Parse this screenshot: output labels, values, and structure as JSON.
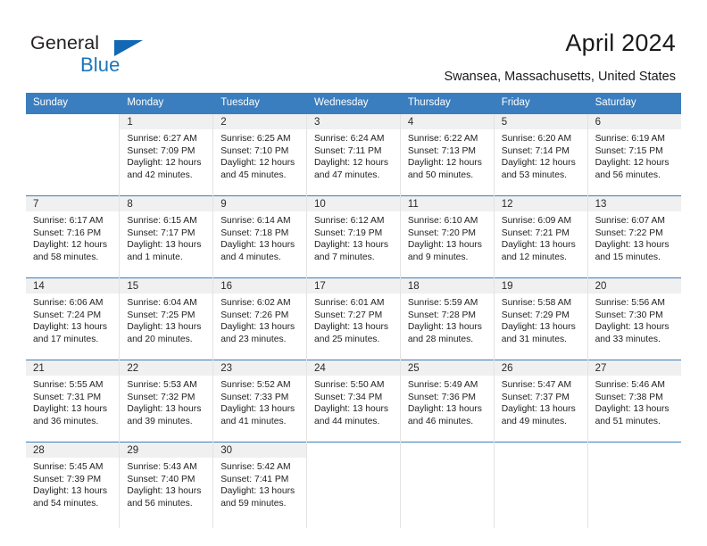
{
  "brand": {
    "name_top": "General",
    "name_bottom": "Blue",
    "accent_color": "#1b75bb",
    "triangle_color": "#1268b3"
  },
  "header": {
    "title": "April 2024",
    "subtitle": "Swansea, Massachusetts, United States"
  },
  "calendar": {
    "header_bg": "#3b7ebf",
    "row_divider_color": "#3b7ebf",
    "day_band_bg": "#f0f0f0",
    "weekdays": [
      "Sunday",
      "Monday",
      "Tuesday",
      "Wednesday",
      "Thursday",
      "Friday",
      "Saturday"
    ],
    "weeks": [
      [
        {
          "day": "",
          "lines": []
        },
        {
          "day": "1",
          "lines": [
            "Sunrise: 6:27 AM",
            "Sunset: 7:09 PM",
            "Daylight: 12 hours and 42 minutes."
          ]
        },
        {
          "day": "2",
          "lines": [
            "Sunrise: 6:25 AM",
            "Sunset: 7:10 PM",
            "Daylight: 12 hours and 45 minutes."
          ]
        },
        {
          "day": "3",
          "lines": [
            "Sunrise: 6:24 AM",
            "Sunset: 7:11 PM",
            "Daylight: 12 hours and 47 minutes."
          ]
        },
        {
          "day": "4",
          "lines": [
            "Sunrise: 6:22 AM",
            "Sunset: 7:13 PM",
            "Daylight: 12 hours and 50 minutes."
          ]
        },
        {
          "day": "5",
          "lines": [
            "Sunrise: 6:20 AM",
            "Sunset: 7:14 PM",
            "Daylight: 12 hours and 53 minutes."
          ]
        },
        {
          "day": "6",
          "lines": [
            "Sunrise: 6:19 AM",
            "Sunset: 7:15 PM",
            "Daylight: 12 hours and 56 minutes."
          ]
        }
      ],
      [
        {
          "day": "7",
          "lines": [
            "Sunrise: 6:17 AM",
            "Sunset: 7:16 PM",
            "Daylight: 12 hours and 58 minutes."
          ]
        },
        {
          "day": "8",
          "lines": [
            "Sunrise: 6:15 AM",
            "Sunset: 7:17 PM",
            "Daylight: 13 hours and 1 minute."
          ]
        },
        {
          "day": "9",
          "lines": [
            "Sunrise: 6:14 AM",
            "Sunset: 7:18 PM",
            "Daylight: 13 hours and 4 minutes."
          ]
        },
        {
          "day": "10",
          "lines": [
            "Sunrise: 6:12 AM",
            "Sunset: 7:19 PM",
            "Daylight: 13 hours and 7 minutes."
          ]
        },
        {
          "day": "11",
          "lines": [
            "Sunrise: 6:10 AM",
            "Sunset: 7:20 PM",
            "Daylight: 13 hours and 9 minutes."
          ]
        },
        {
          "day": "12",
          "lines": [
            "Sunrise: 6:09 AM",
            "Sunset: 7:21 PM",
            "Daylight: 13 hours and 12 minutes."
          ]
        },
        {
          "day": "13",
          "lines": [
            "Sunrise: 6:07 AM",
            "Sunset: 7:22 PM",
            "Daylight: 13 hours and 15 minutes."
          ]
        }
      ],
      [
        {
          "day": "14",
          "lines": [
            "Sunrise: 6:06 AM",
            "Sunset: 7:24 PM",
            "Daylight: 13 hours and 17 minutes."
          ]
        },
        {
          "day": "15",
          "lines": [
            "Sunrise: 6:04 AM",
            "Sunset: 7:25 PM",
            "Daylight: 13 hours and 20 minutes."
          ]
        },
        {
          "day": "16",
          "lines": [
            "Sunrise: 6:02 AM",
            "Sunset: 7:26 PM",
            "Daylight: 13 hours and 23 minutes."
          ]
        },
        {
          "day": "17",
          "lines": [
            "Sunrise: 6:01 AM",
            "Sunset: 7:27 PM",
            "Daylight: 13 hours and 25 minutes."
          ]
        },
        {
          "day": "18",
          "lines": [
            "Sunrise: 5:59 AM",
            "Sunset: 7:28 PM",
            "Daylight: 13 hours and 28 minutes."
          ]
        },
        {
          "day": "19",
          "lines": [
            "Sunrise: 5:58 AM",
            "Sunset: 7:29 PM",
            "Daylight: 13 hours and 31 minutes."
          ]
        },
        {
          "day": "20",
          "lines": [
            "Sunrise: 5:56 AM",
            "Sunset: 7:30 PM",
            "Daylight: 13 hours and 33 minutes."
          ]
        }
      ],
      [
        {
          "day": "21",
          "lines": [
            "Sunrise: 5:55 AM",
            "Sunset: 7:31 PM",
            "Daylight: 13 hours and 36 minutes."
          ]
        },
        {
          "day": "22",
          "lines": [
            "Sunrise: 5:53 AM",
            "Sunset: 7:32 PM",
            "Daylight: 13 hours and 39 minutes."
          ]
        },
        {
          "day": "23",
          "lines": [
            "Sunrise: 5:52 AM",
            "Sunset: 7:33 PM",
            "Daylight: 13 hours and 41 minutes."
          ]
        },
        {
          "day": "24",
          "lines": [
            "Sunrise: 5:50 AM",
            "Sunset: 7:34 PM",
            "Daylight: 13 hours and 44 minutes."
          ]
        },
        {
          "day": "25",
          "lines": [
            "Sunrise: 5:49 AM",
            "Sunset: 7:36 PM",
            "Daylight: 13 hours and 46 minutes."
          ]
        },
        {
          "day": "26",
          "lines": [
            "Sunrise: 5:47 AM",
            "Sunset: 7:37 PM",
            "Daylight: 13 hours and 49 minutes."
          ]
        },
        {
          "day": "27",
          "lines": [
            "Sunrise: 5:46 AM",
            "Sunset: 7:38 PM",
            "Daylight: 13 hours and 51 minutes."
          ]
        }
      ],
      [
        {
          "day": "28",
          "lines": [
            "Sunrise: 5:45 AM",
            "Sunset: 7:39 PM",
            "Daylight: 13 hours and 54 minutes."
          ]
        },
        {
          "day": "29",
          "lines": [
            "Sunrise: 5:43 AM",
            "Sunset: 7:40 PM",
            "Daylight: 13 hours and 56 minutes."
          ]
        },
        {
          "day": "30",
          "lines": [
            "Sunrise: 5:42 AM",
            "Sunset: 7:41 PM",
            "Daylight: 13 hours and 59 minutes."
          ]
        },
        {
          "day": "",
          "lines": []
        },
        {
          "day": "",
          "lines": []
        },
        {
          "day": "",
          "lines": []
        },
        {
          "day": "",
          "lines": []
        }
      ]
    ]
  }
}
